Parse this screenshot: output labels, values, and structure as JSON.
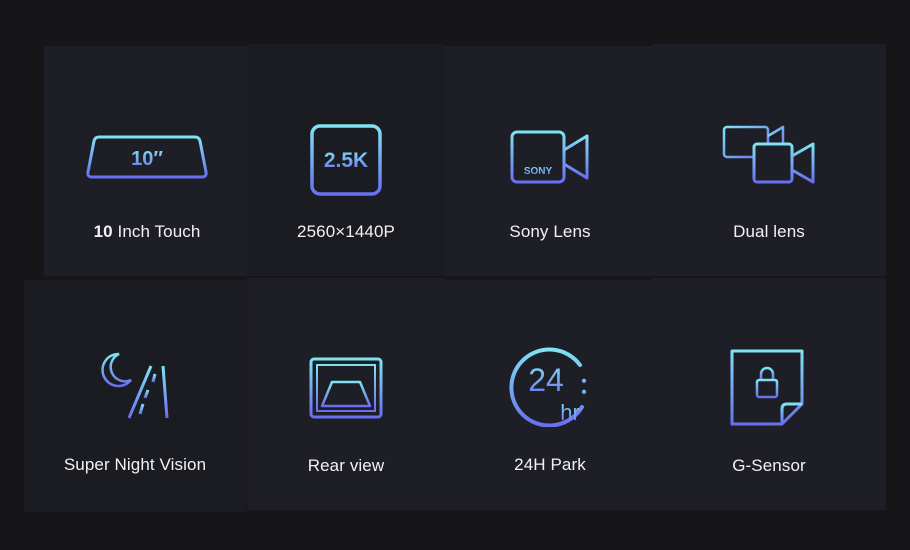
{
  "features": [
    {
      "label_bold": "10",
      "label": " Inch Touch",
      "icon": "mirror-screen-icon",
      "icon_text": "10″"
    },
    {
      "label": "2560×1440P",
      "icon": "resolution-icon",
      "icon_text": "2.5K"
    },
    {
      "label": "Sony Lens",
      "icon": "sony-camera-icon",
      "icon_text": "SONY"
    },
    {
      "label": "Dual lens",
      "icon": "dual-camera-icon"
    },
    {
      "label": "Super Night Vision",
      "icon": "night-vision-icon"
    },
    {
      "label": "Rear view",
      "icon": "rear-view-icon"
    },
    {
      "label": "24H Park",
      "icon": "parking-24h-icon",
      "icon_text": "24",
      "icon_subtext": "hr"
    },
    {
      "label": "G-Sensor",
      "icon": "g-sensor-lock-icon"
    }
  ],
  "colors": {
    "background": "#161619",
    "tile": "#1e1f26",
    "icon_gradient_top": "#7fe3f2",
    "icon_gradient_bottom": "#6a6ff0",
    "text": "#f2f2f4"
  }
}
